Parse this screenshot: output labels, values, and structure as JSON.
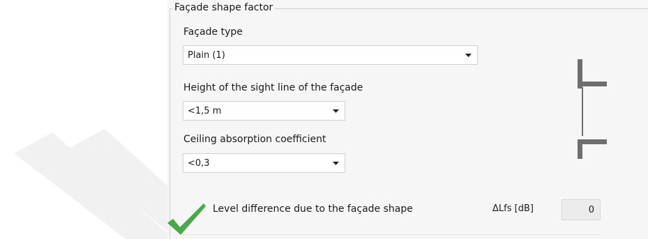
{
  "group": {
    "title": "Façade shape factor"
  },
  "facade_type": {
    "label": "Façade type",
    "value": "Plain (1)"
  },
  "sight_line": {
    "label": "Height of the sight line of the façade",
    "value": "<1,5 m"
  },
  "ceiling_absorption": {
    "label": "Ceiling absorption coefficient",
    "value": "<0,3"
  },
  "result": {
    "label": "Level difference due to the façade shape",
    "symbol_label": "ΔLfs [dB]",
    "value": "0"
  },
  "icons": {
    "status": "checkmark-icon",
    "preview": "facade-profile-icon",
    "dropdown": "chevron-down-icon"
  },
  "colors": {
    "check": "#49a84a",
    "preview_stroke": "#6e6e6e",
    "panel": "#f6f6f6"
  }
}
